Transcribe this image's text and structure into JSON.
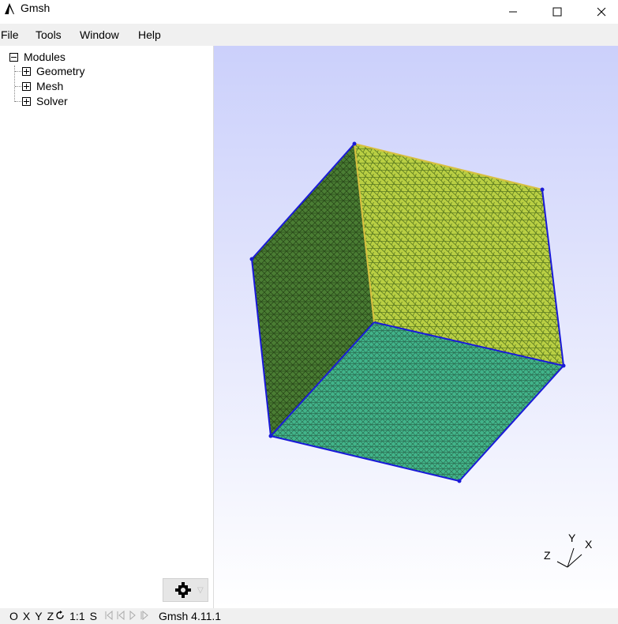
{
  "window": {
    "title": "Gmsh"
  },
  "menu": {
    "file": "File",
    "tools": "Tools",
    "window": "Window",
    "help": "Help"
  },
  "tree": {
    "root": "Modules",
    "items": [
      "Geometry",
      "Mesh",
      "Solver"
    ]
  },
  "axes": {
    "x": "X",
    "y": "Y",
    "z": "Z"
  },
  "status": {
    "o": "O",
    "x": "X",
    "y": "Y",
    "z": "Z",
    "rotate_icon": "rotate-icon",
    "scale": "1:1",
    "s": "S",
    "version": "Gmsh 4.11.1"
  },
  "colors": {
    "edge": "#1a1ad8",
    "face_left": "#3d7a2c",
    "face_back": "#b8cc3a",
    "face_bottom": "#2aa87a",
    "bg_top": "#cbd0fb",
    "bg_bottom": "#ffffff"
  }
}
